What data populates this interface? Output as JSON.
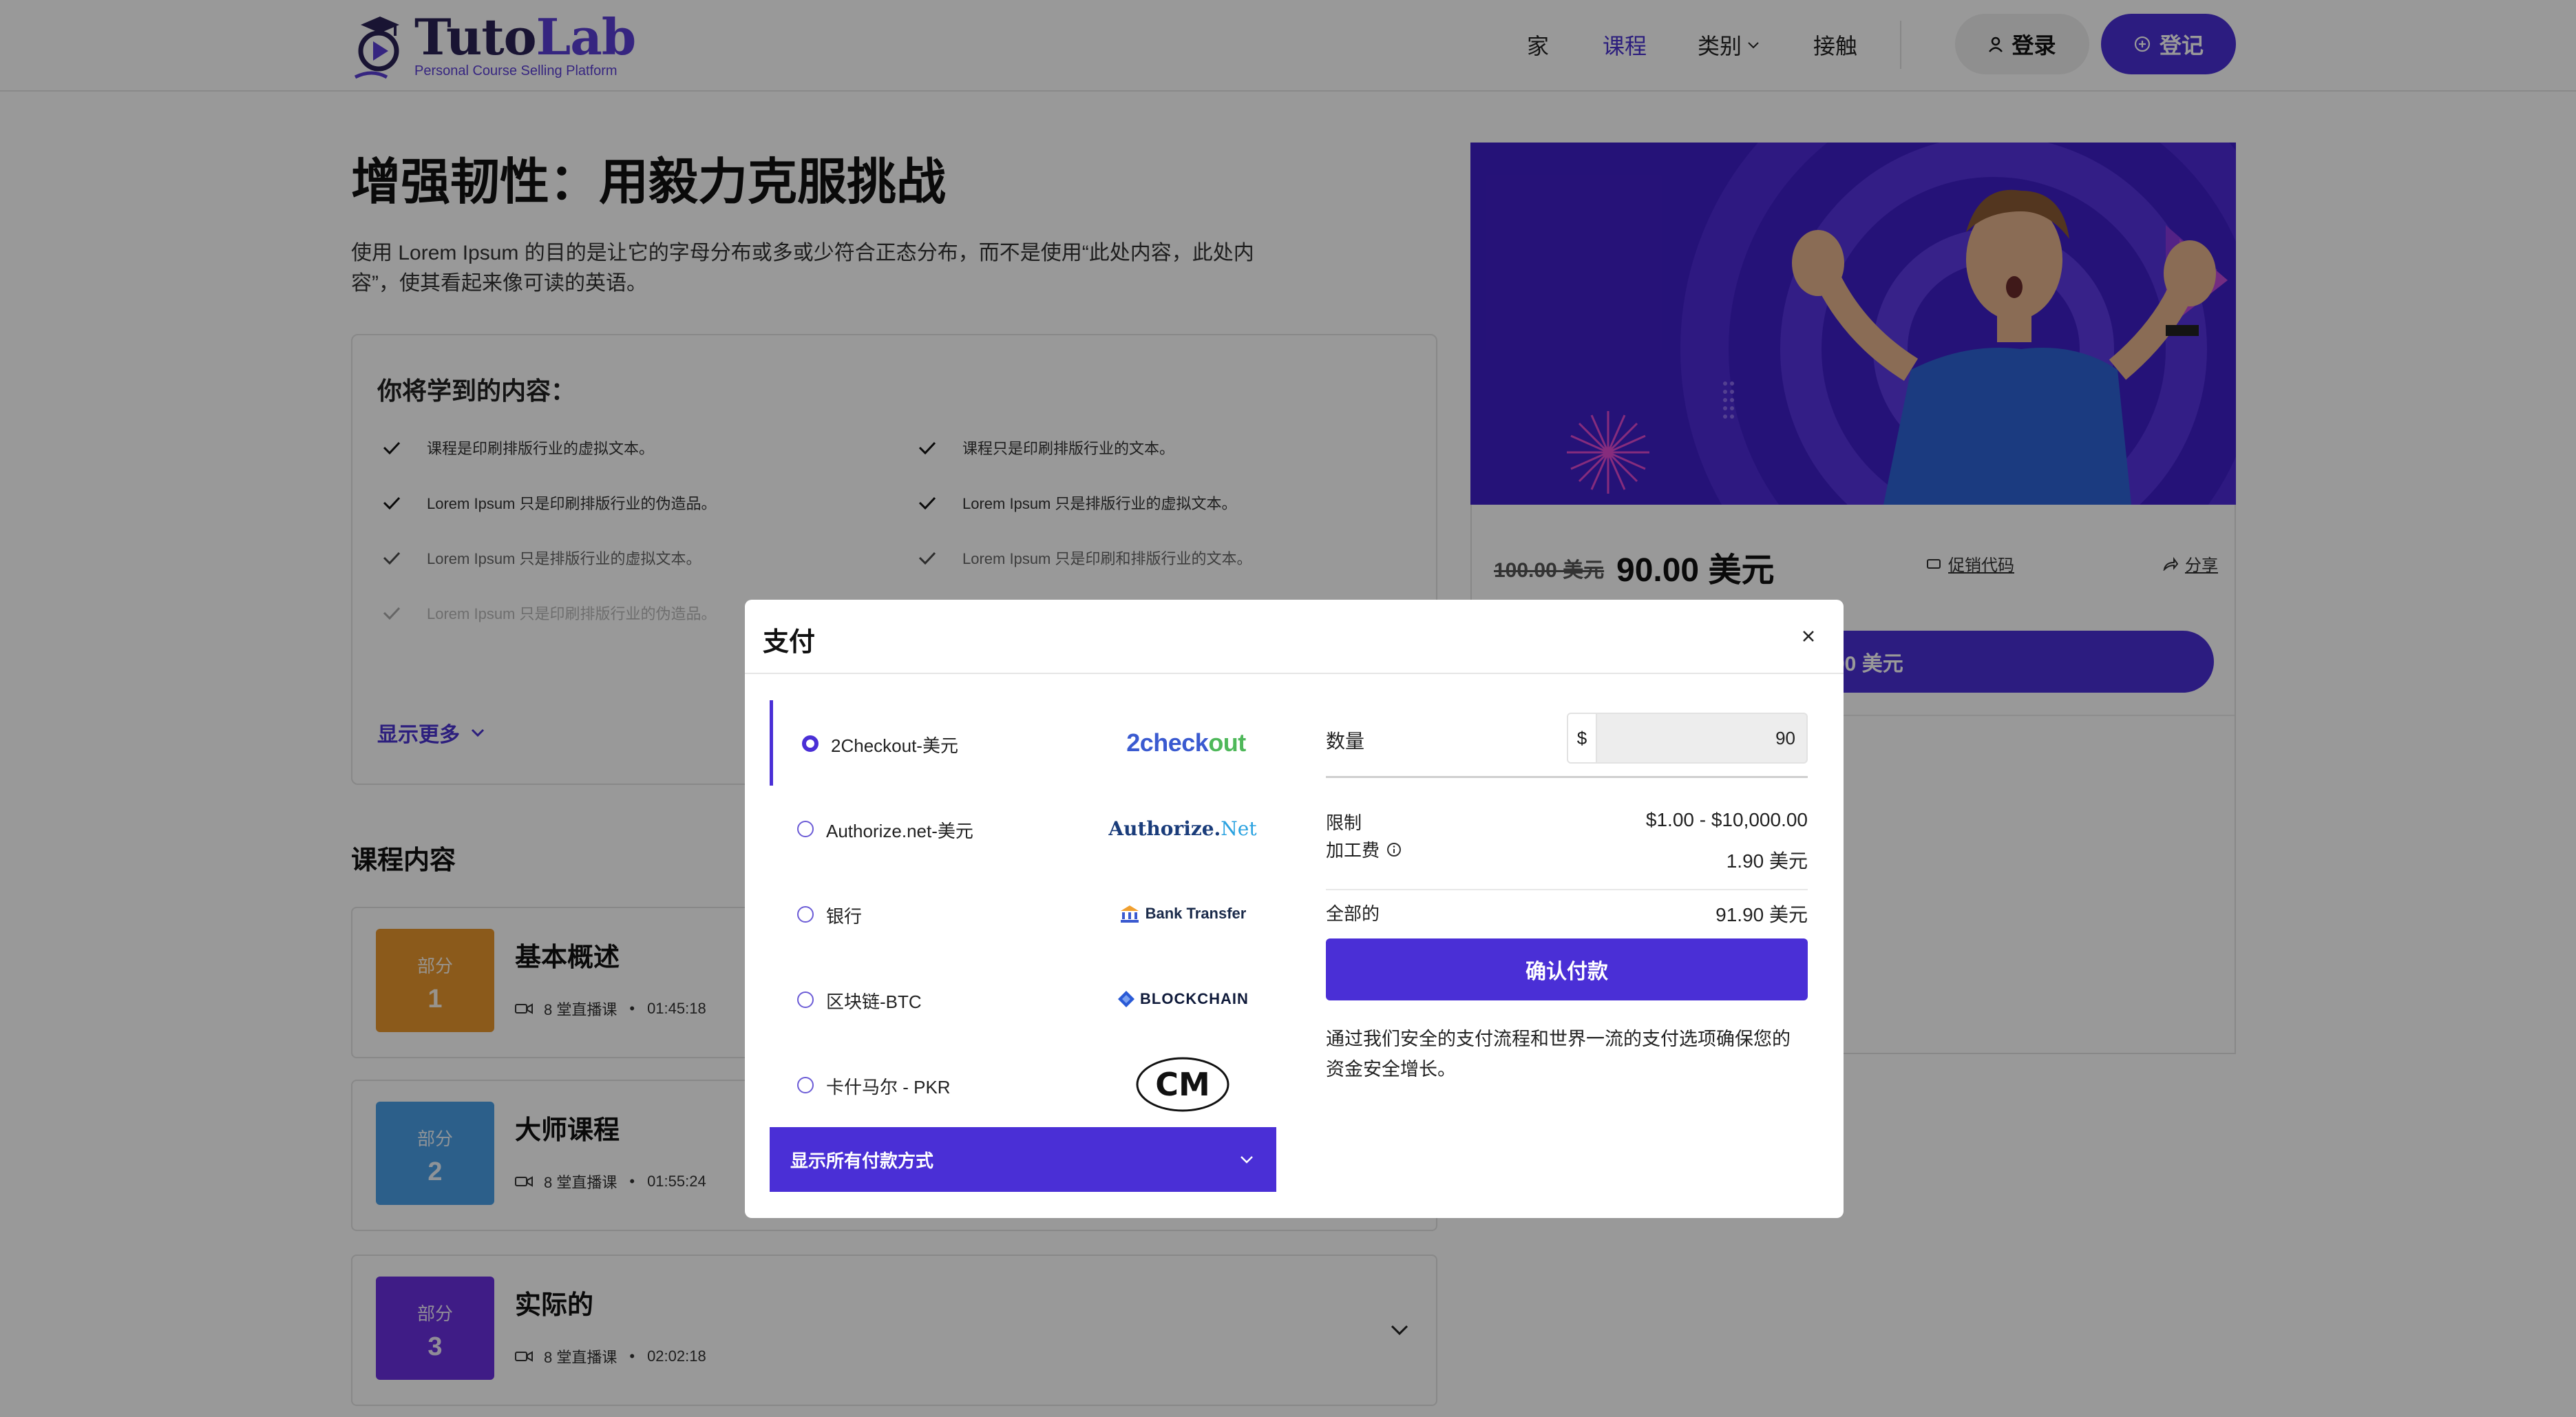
{
  "brand": {
    "name_a": "Tuto",
    "name_b": "Lab",
    "tagline": "Personal Course Selling Platform"
  },
  "nav": {
    "links": [
      "家",
      "课程",
      "类别",
      "接触"
    ],
    "active_index": 1,
    "login_label": "登录",
    "register_label": "登记"
  },
  "course": {
    "title": "增强韧性：用毅力克服挑战",
    "description": "使用 Lorem Ipsum 的目的是让它的字母分布或多或少符合正态分布，而不是使用“此处内容，此处内容”，使其看起来像可读的英语。"
  },
  "learn": {
    "title": "你将学到的内容：",
    "items_left": [
      "课程是印刷排版行业的虚拟文本。",
      "Lorem Ipsum 只是印刷排版行业的伪造品。",
      "Lorem Ipsum 只是排版行业的虚拟文本。",
      "Lorem Ipsum 只是印刷排版行业的伪造品。"
    ],
    "items_right": [
      "课程只是印刷排版行业的文本。",
      "Lorem Ipsum 只是排版行业的虚拟文本。",
      "Lorem Ipsum 只是印刷和排版行业的文本。"
    ],
    "show_more": "显示更多"
  },
  "content": {
    "heading": "课程内容",
    "modules": [
      {
        "badge_label": "部分",
        "badge_num": "1",
        "title": "基本概述",
        "lessons": "8 堂直播课",
        "duration": "01:45:18",
        "color": "#e8962e"
      },
      {
        "badge_label": "部分",
        "badge_num": "2",
        "title": "大师课程",
        "lessons": "8 堂直播课",
        "duration": "01:55:24",
        "color": "#4a9fe6"
      },
      {
        "badge_label": "部分",
        "badge_num": "3",
        "title": "实际的",
        "lessons": "8 堂直播课",
        "duration": "02:02:18",
        "color": "#6a2fe0"
      }
    ]
  },
  "pricing": {
    "old_price": "100.00 美元",
    "new_price": "90.00 美元",
    "promo": "促销代码",
    "share": "分享",
    "buy_label": "90.00 美元"
  },
  "modal": {
    "title": "支付",
    "methods": [
      {
        "label": "2Checkout-美元",
        "logo": "2checkout",
        "selected": true
      },
      {
        "label": "Authorize.net-美元",
        "logo": "Authorize.Net",
        "selected": false
      },
      {
        "label": "银行",
        "logo": "Bank Transfer",
        "selected": false
      },
      {
        "label": "区块链-BTC",
        "logo": "BLOCKCHAIN",
        "selected": false
      },
      {
        "label": "卡什马尔 - PKR",
        "logo": "CM",
        "selected": false
      }
    ],
    "show_all": "显示所有付款方式",
    "qty_label": "数量",
    "currency_prefix": "$",
    "qty_value": "90",
    "limit_label": "限制",
    "limit_value": "$1.00 - $10,000.00",
    "fee_label": "加工费",
    "fee_value": "1.90 美元",
    "total_label": "全部的",
    "total_value": "91.90 美元",
    "confirm_label": "确认付款",
    "secure_note": "通过我们安全的支付流程和世界一流的支付选项确保您的资金安全增长。"
  },
  "colors": {
    "accent": "#4a2fd6",
    "hero_bg": "#3f1ec8"
  }
}
